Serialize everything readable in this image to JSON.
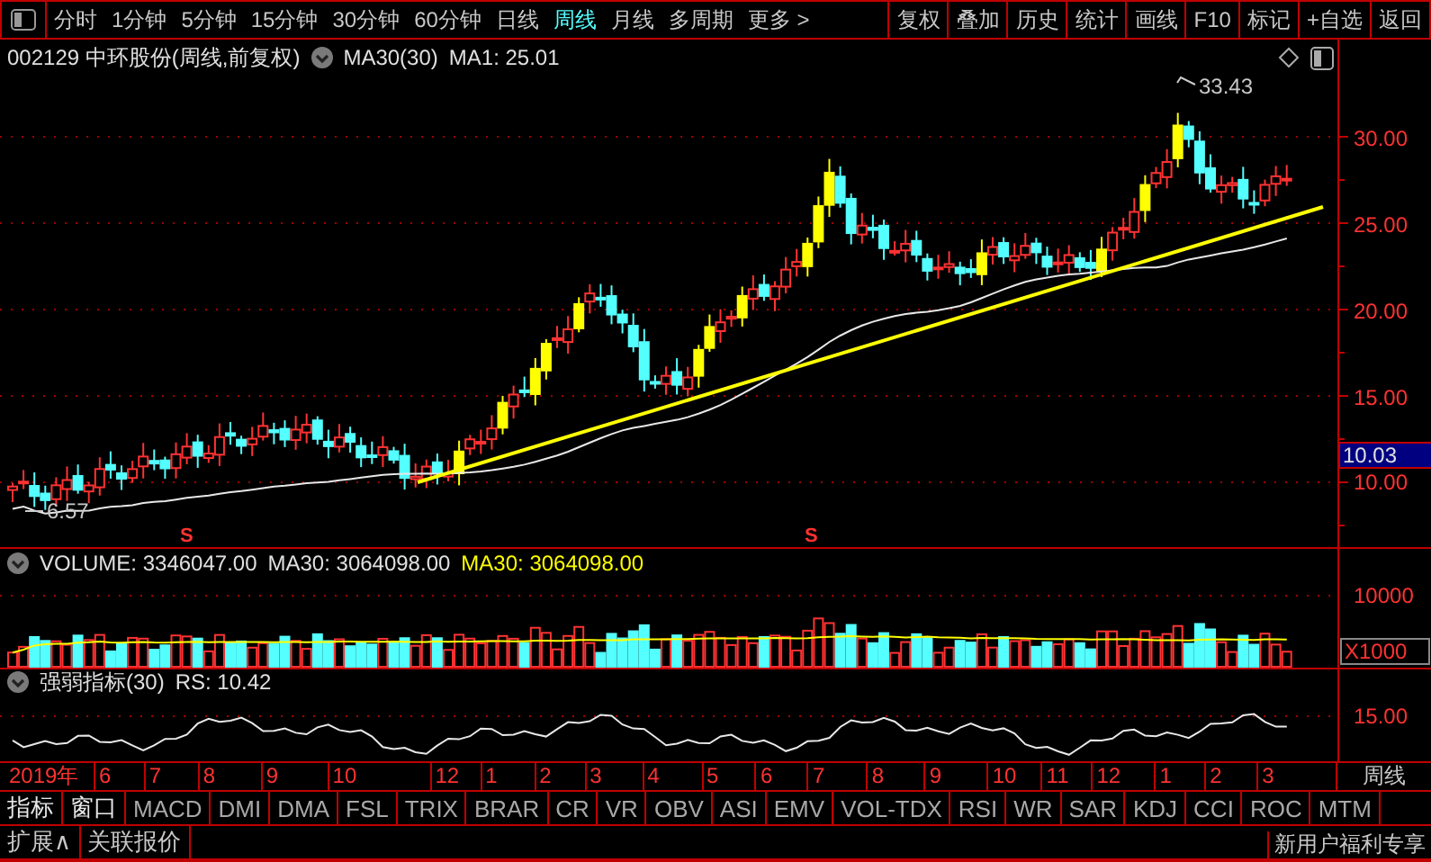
{
  "toolbar": {
    "periods": [
      {
        "label": "分时",
        "selected": false
      },
      {
        "label": "1分钟",
        "selected": false
      },
      {
        "label": "5分钟",
        "selected": false
      },
      {
        "label": "15分钟",
        "selected": false
      },
      {
        "label": "30分钟",
        "selected": false
      },
      {
        "label": "60分钟",
        "selected": false
      },
      {
        "label": "日线",
        "selected": false
      },
      {
        "label": "周线",
        "selected": true
      },
      {
        "label": "月线",
        "selected": false
      },
      {
        "label": "多周期",
        "selected": false
      }
    ],
    "more": "更多 >",
    "buttons": [
      "复权",
      "叠加",
      "历史",
      "统计",
      "画线",
      "F10",
      "标记",
      "+自选",
      "返回"
    ]
  },
  "price_panel": {
    "title": "002129 中环股份(周线,前复权)",
    "indicator": "MA30(30)",
    "reading": "MA1: 25.01",
    "high_label": "33.43",
    "low_label": "6.57",
    "signal_marks": [
      "S",
      "S"
    ],
    "axis_labels": [
      "30.00",
      "25.00",
      "20.00",
      "15.00",
      "10.00"
    ],
    "current_price": "10.03"
  },
  "volume_panel": {
    "reading": "VOLUME: 3346047.00",
    "ma_reading": "MA30: 3064098.00",
    "ma_reading_highlight": "MA30: 3064098.00",
    "axis_label": "10000",
    "unit": "X1000"
  },
  "rs_panel": {
    "title": "强弱指标(30)",
    "reading": "RS: 10.42",
    "axis_label": "15.00"
  },
  "time_axis": {
    "labels": [
      "2019年",
      "6",
      "7",
      "8",
      "9",
      "10",
      "12",
      "1",
      "2",
      "3",
      "4",
      "5",
      "6",
      "7",
      "8",
      "9",
      "10",
      "11",
      "12",
      "1",
      "2",
      "3"
    ],
    "period": "周线"
  },
  "indicator_tabs": [
    {
      "label": "指标",
      "kind": "menu"
    },
    {
      "label": "窗口",
      "kind": "menu"
    },
    {
      "label": "MACD",
      "kind": "indicator"
    },
    {
      "label": "DMI",
      "kind": "indicator"
    },
    {
      "label": "DMA",
      "kind": "indicator"
    },
    {
      "label": "FSL",
      "kind": "indicator"
    },
    {
      "label": "TRIX",
      "kind": "indicator"
    },
    {
      "label": "BRAR",
      "kind": "indicator"
    },
    {
      "label": "CR",
      "kind": "indicator"
    },
    {
      "label": "VR",
      "kind": "indicator"
    },
    {
      "label": "OBV",
      "kind": "indicator"
    },
    {
      "label": "ASI",
      "kind": "indicator"
    },
    {
      "label": "EMV",
      "kind": "indicator"
    },
    {
      "label": "VOL-TDX",
      "kind": "indicator"
    },
    {
      "label": "RSI",
      "kind": "indicator"
    },
    {
      "label": "WR",
      "kind": "indicator"
    },
    {
      "label": "SAR",
      "kind": "indicator"
    },
    {
      "label": "KDJ",
      "kind": "indicator"
    },
    {
      "label": "CCI",
      "kind": "indicator"
    },
    {
      "label": "ROC",
      "kind": "indicator"
    },
    {
      "label": "MTM",
      "kind": "indicator"
    }
  ],
  "bottom_bar": {
    "buttons": [
      "扩展∧",
      "关联报价"
    ],
    "promo": "新用户福利专享"
  }
}
